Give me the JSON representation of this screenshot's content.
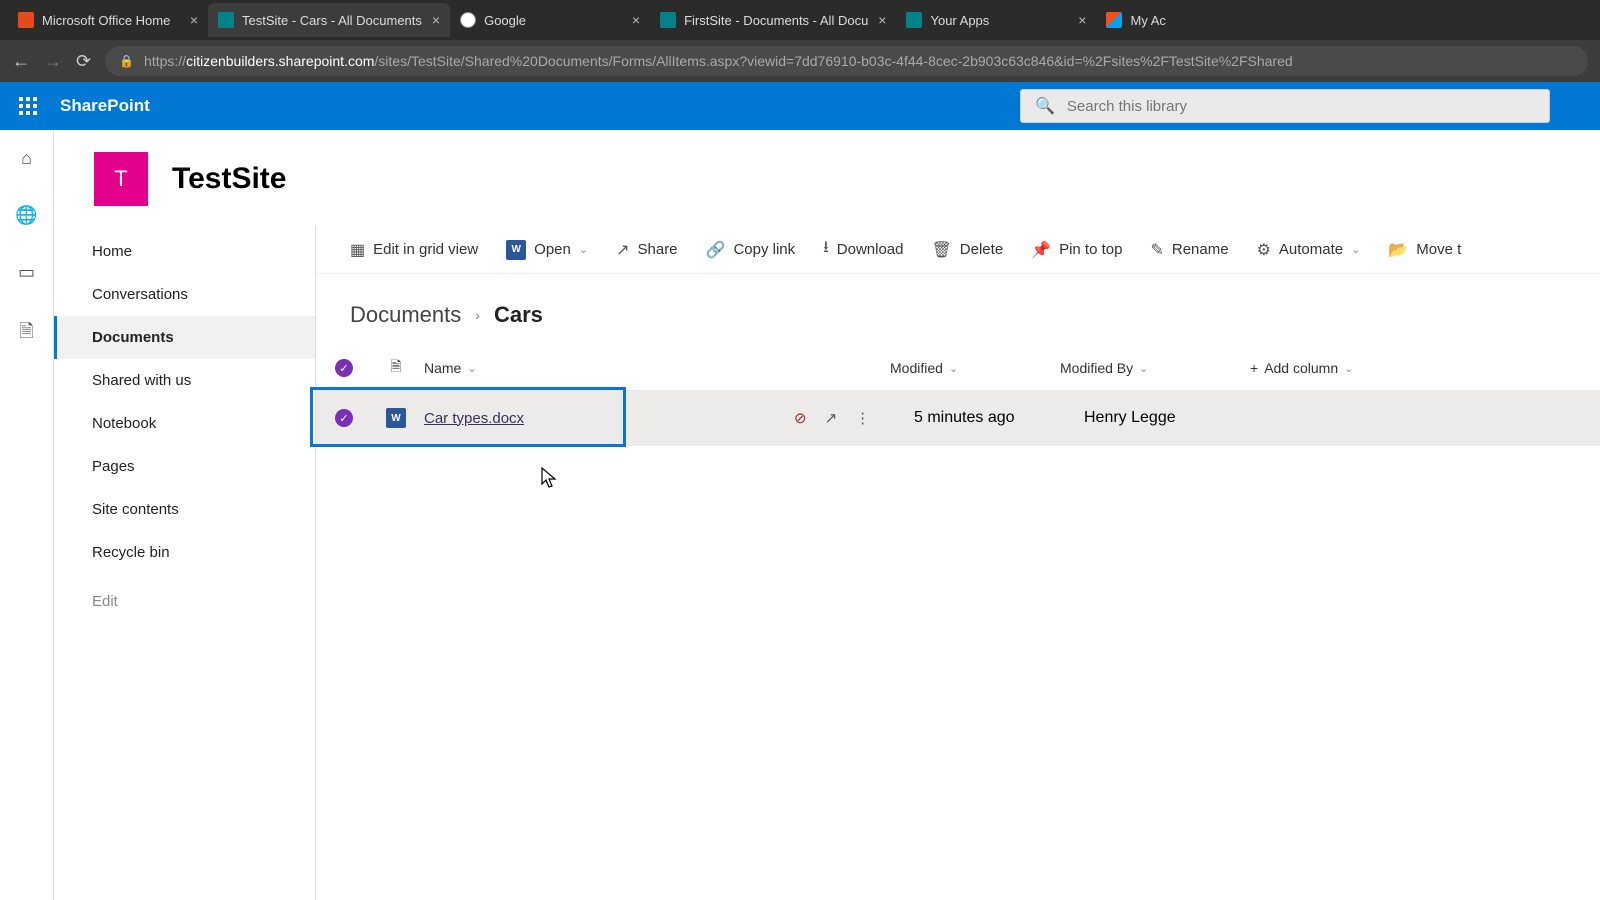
{
  "browser": {
    "tabs": [
      {
        "label": "Microsoft Office Home",
        "iconColor": "#e64a19"
      },
      {
        "label": "TestSite - Cars - All Documents",
        "iconColor": "#038387",
        "active": true
      },
      {
        "label": "Google",
        "iconColor": "#4285f4"
      },
      {
        "label": "FirstSite - Documents - All Docu",
        "iconColor": "#038387"
      },
      {
        "label": "Your Apps",
        "iconColor": "#038387"
      }
    ],
    "extraTab": "My Ac",
    "url_host": "citizenbuilders.sharepoint.com",
    "url_path": "/sites/TestSite/Shared%20Documents/Forms/AllItems.aspx?viewid=7dd76910-b03c-4f44-8cec-2b903c63c846&id=%2Fsites%2FTestSite%2FShared"
  },
  "suite": {
    "appName": "SharePoint",
    "searchPlaceholder": "Search this library"
  },
  "site": {
    "logoLetter": "T",
    "title": "TestSite"
  },
  "leftNav": {
    "items": [
      "Home",
      "Conversations",
      "Documents",
      "Shared with us",
      "Notebook",
      "Pages",
      "Site contents",
      "Recycle bin"
    ],
    "selected": "Documents",
    "editLabel": "Edit"
  },
  "commandBar": {
    "editGrid": "Edit in grid view",
    "open": "Open",
    "share": "Share",
    "copyLink": "Copy link",
    "download": "Download",
    "delete": "Delete",
    "pin": "Pin to top",
    "rename": "Rename",
    "automate": "Automate",
    "move": "Move t"
  },
  "breadcrumb": {
    "root": "Documents",
    "current": "Cars"
  },
  "list": {
    "headers": {
      "name": "Name",
      "modified": "Modified",
      "modifiedBy": "Modified By",
      "addColumn": "Add column"
    },
    "rows": [
      {
        "name": "Car types.docx",
        "modified": "5 minutes ago",
        "modifiedBy": "Henry Legge",
        "selected": true
      }
    ]
  }
}
